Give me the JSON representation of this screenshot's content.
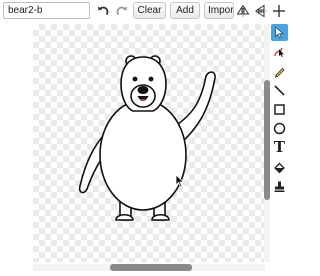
{
  "costume": {
    "name_value": "bear2-b"
  },
  "toolbar": {
    "clear_label": "Clear",
    "add_label": "Add",
    "import_label": "Import"
  },
  "icons": {
    "undo": "undo-icon",
    "redo": "redo-icon",
    "flip_horizontal": "flip-horizontal-icon",
    "flip_vertical": "flip-vertical-icon",
    "set_center": "set-costume-center-icon"
  },
  "tools": [
    {
      "name": "select",
      "icon": "arrow-select-icon",
      "active": true
    },
    {
      "name": "reshape",
      "icon": "reshape-icon",
      "active": false
    },
    {
      "name": "pencil",
      "icon": "pencil-icon",
      "active": false
    },
    {
      "name": "line",
      "icon": "line-icon",
      "active": false
    },
    {
      "name": "rectangle",
      "icon": "rectangle-icon",
      "active": false
    },
    {
      "name": "ellipse",
      "icon": "ellipse-icon",
      "active": false
    },
    {
      "name": "text",
      "label": "T",
      "active": false
    },
    {
      "name": "fill",
      "icon": "paint-bucket-icon",
      "active": false
    },
    {
      "name": "stamp",
      "icon": "stamp-icon",
      "active": false
    }
  ],
  "colors": {
    "accent": "#4aa3df",
    "canvas_checker": "#eaeaea",
    "scroll_thumb": "#8a8a8a",
    "reshape_red": "#d93a3a"
  }
}
